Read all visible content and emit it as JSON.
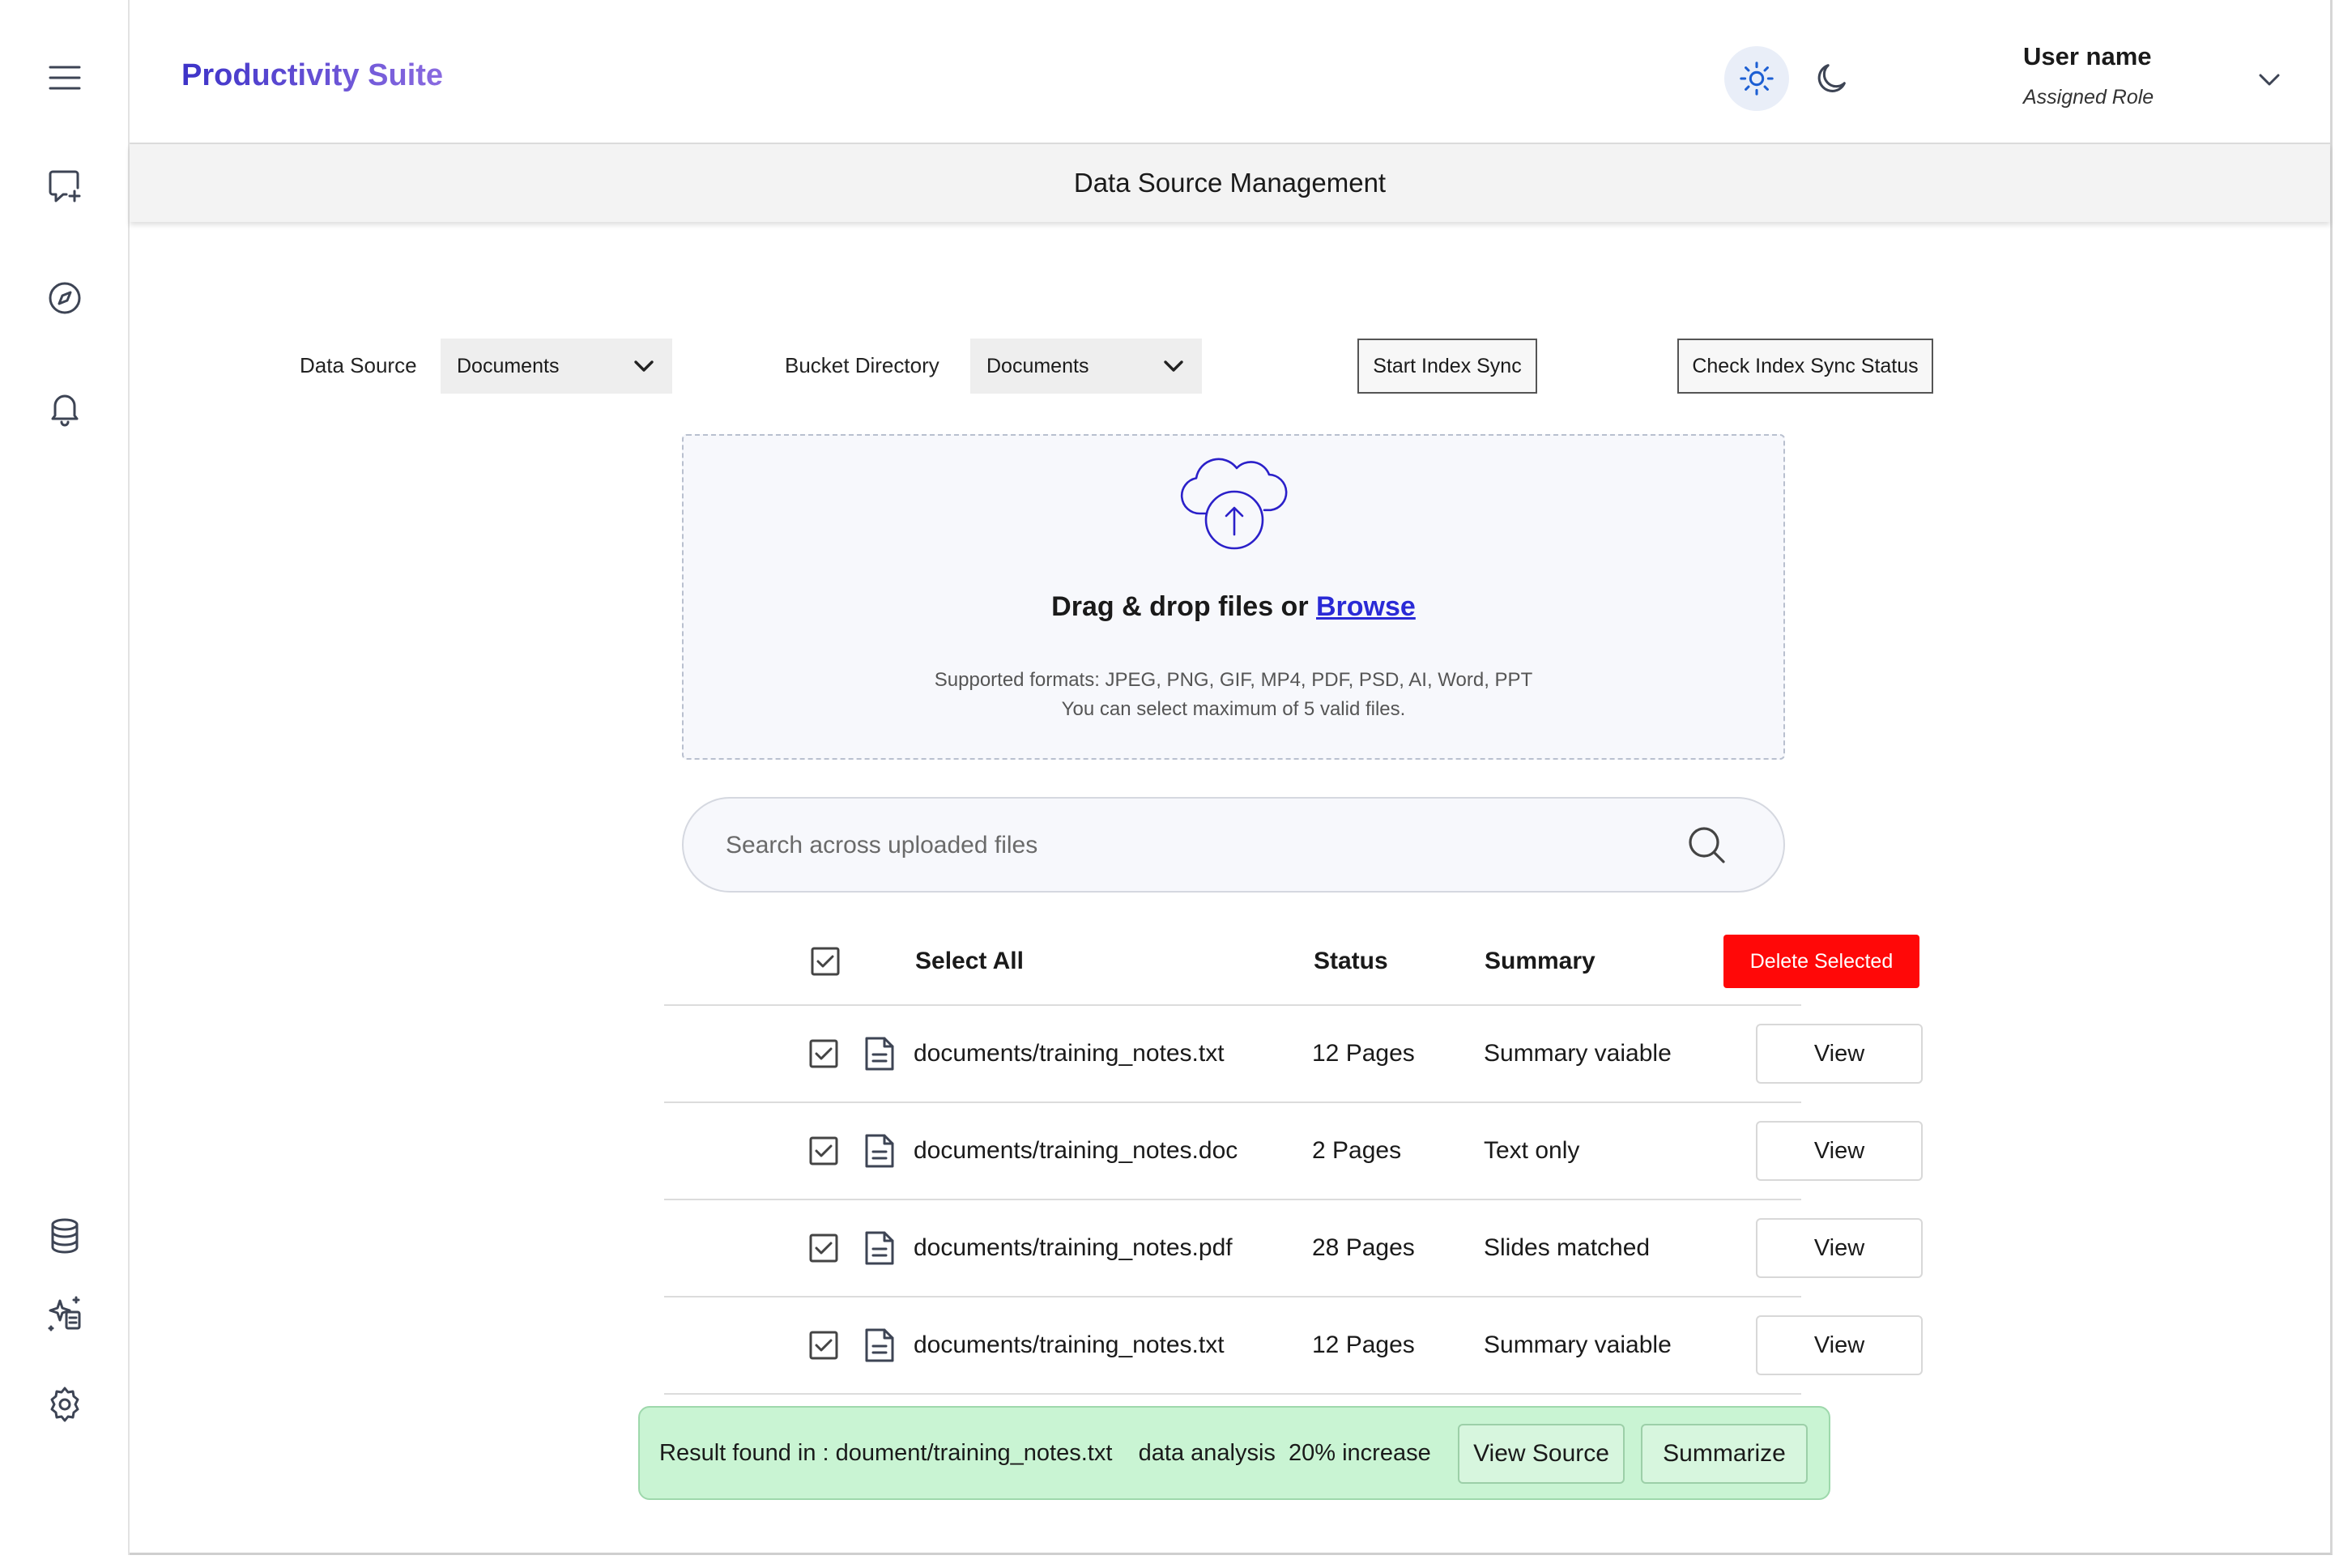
{
  "app": {
    "brand": "Productivity Suite"
  },
  "header": {
    "user_name": "User name",
    "user_role": "Assigned Role"
  },
  "page": {
    "title": "Data Source Management"
  },
  "controls": {
    "data_source_label": "Data Source",
    "data_source_value": "Documents",
    "bucket_label": "Bucket Directory",
    "bucket_value": "Documents",
    "start_sync": "Start Index Sync",
    "check_sync": "Check Index Sync Status"
  },
  "upload": {
    "title": "Drag & drop files or",
    "browse": "Browse",
    "formats": "Supported formats: JPEG, PNG, GIF, MP4, PDF, PSD, AI, Word, PPT",
    "max": "You can select maximum of 5 valid files."
  },
  "search": {
    "placeholder": "Search across uploaded files"
  },
  "table": {
    "headers": {
      "select_all": "Select All",
      "status": "Status",
      "summary": "Summary"
    },
    "delete_label": "Delete Selected",
    "view_label": "View",
    "rows": [
      {
        "file": "documents/training_notes.txt",
        "status": "12 Pages",
        "summary": "Summary vaiable"
      },
      {
        "file": "documents/training_notes.doc",
        "status": "2 Pages",
        "summary": "Text only"
      },
      {
        "file": "documents/training_notes.pdf",
        "status": "28 Pages",
        "summary": "Slides matched"
      },
      {
        "file": "documents/training_notes.txt",
        "status": "12 Pages",
        "summary": "Summary vaiable"
      }
    ]
  },
  "result": {
    "text": "Result found in : doument/training_notes.txt    data analysis  20% increase",
    "view_source": "View Source",
    "summarize": "Summarize"
  },
  "colors": {
    "brand_start": "#3d33c8",
    "brand_end": "#8a6be0",
    "danger": "#ff0808",
    "success_bg": "#c9f4d3",
    "link": "#2a2ad6"
  }
}
